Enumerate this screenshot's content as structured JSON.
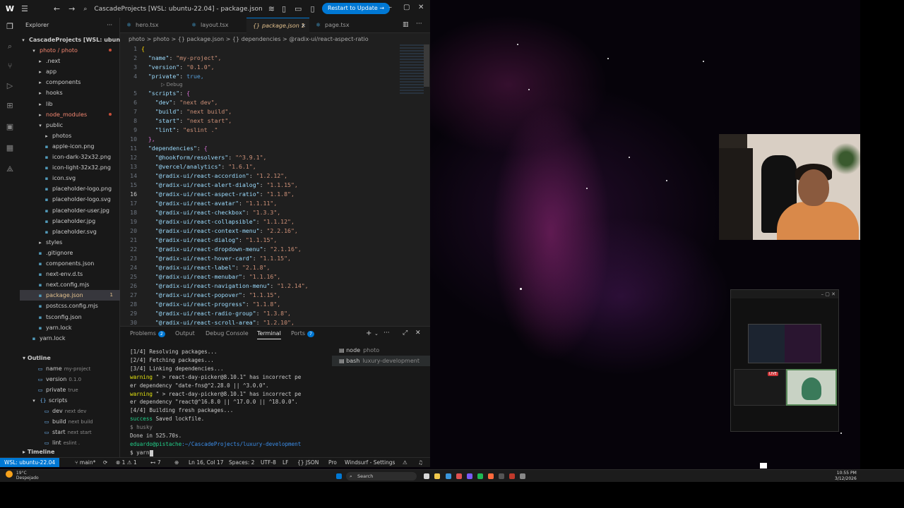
{
  "window": {
    "title": "CascadeProjects [WSL: ubuntu-22.04] - package.json",
    "restart_label": "Restart to Update →"
  },
  "sidebar": {
    "header": "Explorer",
    "root": "CascadeProjects [WSL: ubuntu-2...",
    "tree": [
      {
        "label": "photo / photo",
        "indent": 1,
        "kind": "folder-open",
        "color": "red",
        "dot": true
      },
      {
        "label": ".next",
        "indent": 2,
        "kind": "folder"
      },
      {
        "label": "app",
        "indent": 2,
        "kind": "folder"
      },
      {
        "label": "components",
        "indent": 2,
        "kind": "folder"
      },
      {
        "label": "hooks",
        "indent": 2,
        "kind": "folder"
      },
      {
        "label": "lib",
        "indent": 2,
        "kind": "folder"
      },
      {
        "label": "node_modules",
        "indent": 2,
        "kind": "folder",
        "color": "red",
        "dot": true
      },
      {
        "label": "public",
        "indent": 2,
        "kind": "folder-open"
      },
      {
        "label": "photos",
        "indent": 3,
        "kind": "folder"
      },
      {
        "label": "apple-icon.png",
        "indent": 3,
        "kind": "file"
      },
      {
        "label": "icon-dark-32x32.png",
        "indent": 3,
        "kind": "file"
      },
      {
        "label": "icon-light-32x32.png",
        "indent": 3,
        "kind": "file"
      },
      {
        "label": "icon.svg",
        "indent": 3,
        "kind": "file"
      },
      {
        "label": "placeholder-logo.png",
        "indent": 3,
        "kind": "file"
      },
      {
        "label": "placeholder-logo.svg",
        "indent": 3,
        "kind": "file"
      },
      {
        "label": "placeholder-user.jpg",
        "indent": 3,
        "kind": "file"
      },
      {
        "label": "placeholder.jpg",
        "indent": 3,
        "kind": "file"
      },
      {
        "label": "placeholder.svg",
        "indent": 3,
        "kind": "file"
      },
      {
        "label": "styles",
        "indent": 2,
        "kind": "folder"
      },
      {
        "label": ".gitignore",
        "indent": 2,
        "kind": "file"
      },
      {
        "label": "components.json",
        "indent": 2,
        "kind": "file"
      },
      {
        "label": "next-env.d.ts",
        "indent": 2,
        "kind": "file"
      },
      {
        "label": "next.config.mjs",
        "indent": 2,
        "kind": "file"
      },
      {
        "label": "package.json",
        "indent": 2,
        "kind": "file",
        "color": "yellow",
        "selected": true,
        "badge": "1"
      },
      {
        "label": "postcss.config.mjs",
        "indent": 2,
        "kind": "file"
      },
      {
        "label": "tsconfig.json",
        "indent": 2,
        "kind": "file"
      },
      {
        "label": "yarn.lock",
        "indent": 2,
        "kind": "file"
      },
      {
        "label": "yarn.lock",
        "indent": 1,
        "kind": "file"
      }
    ],
    "outline_header": "Outline",
    "outline": [
      {
        "key": "name",
        "value": "my-project",
        "indent": 2
      },
      {
        "key": "version",
        "value": "0.1.0",
        "indent": 2
      },
      {
        "key": "private",
        "value": "true",
        "indent": 2
      },
      {
        "key": "scripts",
        "value": "",
        "indent": 1,
        "open": true
      },
      {
        "key": "dev",
        "value": "next dev",
        "indent": 3
      },
      {
        "key": "build",
        "value": "next build",
        "indent": 3
      },
      {
        "key": "start",
        "value": "next start",
        "indent": 3
      },
      {
        "key": "lint",
        "value": "eslint .",
        "indent": 3
      }
    ],
    "timeline_header": "Timeline"
  },
  "tabs": [
    {
      "label": "hero.tsx",
      "active": false
    },
    {
      "label": "layout.tsx",
      "active": false
    },
    {
      "label": "package.json 1",
      "active": true
    },
    {
      "label": "page.tsx",
      "active": false
    }
  ],
  "breadcrumb": "photo > photo > {} package.json > {} dependencies > @radix-ui/react-aspect-ratio",
  "editor": {
    "current_line": 16,
    "codelens_debug": "▷ Debug",
    "lines": [
      {
        "n": 1,
        "k": "",
        "v": "{",
        "t": "open"
      },
      {
        "n": 2,
        "k": "\"name\"",
        "v": "\"my-project\","
      },
      {
        "n": 3,
        "k": "\"version\"",
        "v": "\"0.1.0\","
      },
      {
        "n": 4,
        "k": "\"private\"",
        "v": "true,",
        "t": "bool"
      },
      {
        "n": 5,
        "k": "\"scripts\"",
        "v": "{",
        "t": "obj"
      },
      {
        "n": 6,
        "k": "\"dev\"",
        "v": "\"next dev\",",
        "i": 2
      },
      {
        "n": 7,
        "k": "\"build\"",
        "v": "\"next build\",",
        "i": 2
      },
      {
        "n": 8,
        "k": "\"start\"",
        "v": "\"next start\",",
        "i": 2
      },
      {
        "n": 9,
        "k": "\"lint\"",
        "v": "\"eslint .\"",
        "i": 2
      },
      {
        "n": 10,
        "k": "",
        "v": "},",
        "t": "close"
      },
      {
        "n": 11,
        "k": "\"dependencies\"",
        "v": "{",
        "t": "obj"
      },
      {
        "n": 12,
        "k": "\"@hookform/resolvers\"",
        "v": "\"^3.9.1\",",
        "i": 2
      },
      {
        "n": 13,
        "k": "\"@vercel/analytics\"",
        "v": "\"1.6.1\",",
        "i": 2
      },
      {
        "n": 14,
        "k": "\"@radix-ui/react-accordion\"",
        "v": "\"1.2.12\",",
        "i": 2
      },
      {
        "n": 15,
        "k": "\"@radix-ui/react-alert-dialog\"",
        "v": "\"1.1.15\",",
        "i": 2
      },
      {
        "n": 16,
        "k": "\"@radix-ui/react-aspect-ratio\"",
        "v": "\"1.1.8\",",
        "i": 2
      },
      {
        "n": 17,
        "k": "\"@radix-ui/react-avatar\"",
        "v": "\"1.1.11\",",
        "i": 2
      },
      {
        "n": 18,
        "k": "\"@radix-ui/react-checkbox\"",
        "v": "\"1.3.3\",",
        "i": 2
      },
      {
        "n": 19,
        "k": "\"@radix-ui/react-collapsible\"",
        "v": "\"1.1.12\",",
        "i": 2
      },
      {
        "n": 20,
        "k": "\"@radix-ui/react-context-menu\"",
        "v": "\"2.2.16\",",
        "i": 2
      },
      {
        "n": 21,
        "k": "\"@radix-ui/react-dialog\"",
        "v": "\"1.1.15\",",
        "i": 2
      },
      {
        "n": 22,
        "k": "\"@radix-ui/react-dropdown-menu\"",
        "v": "\"2.1.16\",",
        "i": 2
      },
      {
        "n": 23,
        "k": "\"@radix-ui/react-hover-card\"",
        "v": "\"1.1.15\",",
        "i": 2
      },
      {
        "n": 24,
        "k": "\"@radix-ui/react-label\"",
        "v": "\"2.1.8\",",
        "i": 2
      },
      {
        "n": 25,
        "k": "\"@radix-ui/react-menubar\"",
        "v": "\"1.1.16\",",
        "i": 2
      },
      {
        "n": 26,
        "k": "\"@radix-ui/react-navigation-menu\"",
        "v": "\"1.2.14\",",
        "i": 2
      },
      {
        "n": 27,
        "k": "\"@radix-ui/react-popover\"",
        "v": "\"1.1.15\",",
        "i": 2
      },
      {
        "n": 28,
        "k": "\"@radix-ui/react-progress\"",
        "v": "\"1.1.8\",",
        "i": 2
      },
      {
        "n": 29,
        "k": "\"@radix-ui/react-radio-group\"",
        "v": "\"1.3.8\",",
        "i": 2
      },
      {
        "n": 30,
        "k": "\"@radix-ui/react-scroll-area\"",
        "v": "\"1.2.10\",",
        "i": 2
      }
    ]
  },
  "panel": {
    "tabs": [
      {
        "label": "Problems",
        "badge": "2"
      },
      {
        "label": "Output",
        "badge": ""
      },
      {
        "label": "Debug Console",
        "badge": ""
      },
      {
        "label": "Terminal",
        "badge": "",
        "active": true
      },
      {
        "label": "Ports",
        "badge": "7"
      }
    ],
    "terminal_lines": [
      {
        "text": "[1/4] Resolving packages...",
        "style": ""
      },
      {
        "text": "[2/4] Fetching packages...",
        "style": ""
      },
      {
        "text": "[3/4] Linking dependencies...",
        "style": ""
      },
      {
        "prefix": "warning",
        "text": " \" > react-day-picker@8.10.1\" has incorrect pe",
        "style": "warn"
      },
      {
        "text": "er dependency \"date-fns@^2.28.0 || ^3.0.0\".",
        "style": ""
      },
      {
        "prefix": "warning",
        "text": " \" > react-day-picker@8.10.1\" has incorrect pe",
        "style": "warn"
      },
      {
        "text": "er dependency \"react@^16.8.0 || ^17.0.0 || ^18.0.0\".",
        "style": ""
      },
      {
        "text": "[4/4] Building fresh packages...",
        "style": ""
      },
      {
        "prefix": "success",
        "text": " Saved lockfile.",
        "style": "ok"
      },
      {
        "text": "$ husky",
        "style": "dim"
      },
      {
        "text": "Done in 525.70s.",
        "style": ""
      },
      {
        "prefix": "eduardo@pistache",
        "text": ":~/CascadeProjects/luxury-development",
        "style": "prompt"
      },
      {
        "text": "$ yarn",
        "style": ""
      }
    ],
    "terminals": [
      {
        "name": "node",
        "sub": "photo",
        "selected": false
      },
      {
        "name": "bash",
        "sub": "luxury-development",
        "selected": true
      }
    ]
  },
  "statusbar": {
    "remote": "WSL: ubuntu-22.04",
    "branch": "main*",
    "errors": "1",
    "warnings": "1",
    "ports": "7",
    "position": "Ln 16, Col 17",
    "spaces": "Spaces: 2",
    "encoding": "UTF-8",
    "eol": "LF",
    "language": "{} JSON",
    "plan": "Pro",
    "windsurf": "Windsurf - Settings"
  },
  "taskbar": {
    "weather_temp": "19°C",
    "weather_desc": "Despejado",
    "search_placeholder": "Search",
    "time": "10:55 PM",
    "date": "3/12/2026"
  },
  "mini_window": {
    "live_label": "LIVE"
  }
}
